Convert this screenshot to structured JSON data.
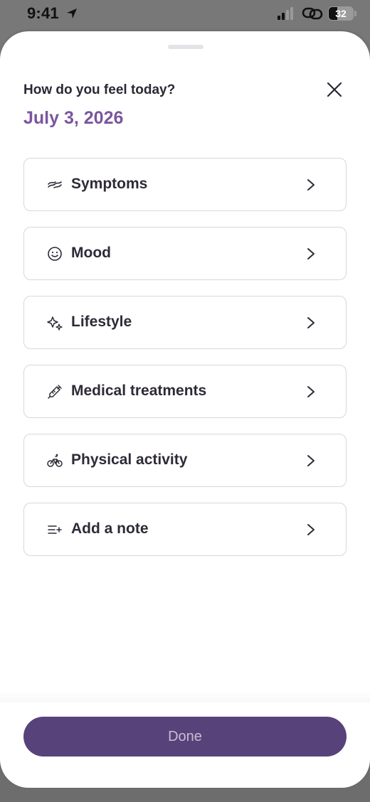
{
  "status_bar": {
    "time": "9:41",
    "battery": "32"
  },
  "sheet": {
    "question": "How do you feel today?",
    "date": "July 3, 2026"
  },
  "menu": {
    "items": [
      {
        "label": "Symptoms",
        "icon": "symptoms-icon"
      },
      {
        "label": "Mood",
        "icon": "smile-icon"
      },
      {
        "label": "Lifestyle",
        "icon": "sparkles-icon"
      },
      {
        "label": "Medical treatments",
        "icon": "syringe-icon"
      },
      {
        "label": "Physical activity",
        "icon": "bicycle-icon"
      },
      {
        "label": "Add a note",
        "icon": "add-note-icon"
      }
    ]
  },
  "footer": {
    "done_label": "Done"
  },
  "colors": {
    "accent": "#7a569e",
    "button": "#58427a",
    "button_text": "#c7bdd4"
  }
}
